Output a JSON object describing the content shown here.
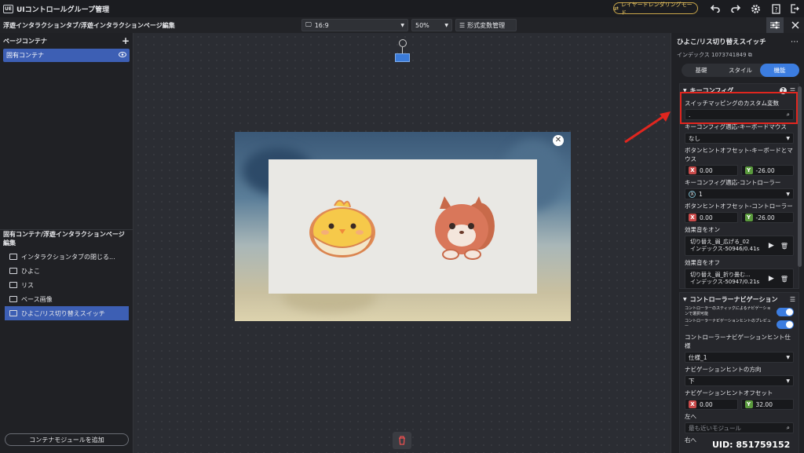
{
  "app": {
    "icon_text": "UE",
    "title": "UIコントロールグループ管理",
    "layer_mode": "レイヤードレンダリングモード"
  },
  "toolbar": {
    "breadcrumb": "浮遊インタラクションタブ/浮遊インタラクションページ編集",
    "aspect": "16:9",
    "zoom": "50%",
    "format_vars": "形式変数管理"
  },
  "left_panel": {
    "page_content_title": "ページコンテナ",
    "fixed_container": "固有コンテナ",
    "tree_title": "固有コンテナ/浮遊インタラクションページ編集",
    "tree_items": [
      {
        "label": "インタラクションタブの閉じる..."
      },
      {
        "label": "ひよこ"
      },
      {
        "label": "リス"
      },
      {
        "label": "ベース画像"
      },
      {
        "label": "ひよこ/リス切り替えスイッチ"
      }
    ],
    "add_module": "コンテナモジュールを追加"
  },
  "right_panel": {
    "title": "ひよこ/リス切り替えスイッチ",
    "index": "インデックス 1073741849",
    "tabs": [
      "基礎",
      "スタイル",
      "機能"
    ],
    "key_config": {
      "header": "キーコンフィグ",
      "custom_var_label": "スイッチマッピングのカスタム変数",
      "custom_var_value": ".",
      "kbm_label": "キーコンフィグ適応-キーボードマウス",
      "kbm_value": "なし",
      "kbm_offset_label": "ボタンヒントオフセット-キーボードとマウス",
      "kbm_offset_x": "0.00",
      "kbm_offset_y": "-26.00",
      "ctrl_label": "キーコンフィグ適応-コントローラー",
      "ctrl_value": "1",
      "ctrl_offset_label": "ボタンヒントオフセット-コントローラー",
      "ctrl_offset_x": "0.00",
      "ctrl_offset_y": "-26.00",
      "sound_on_label": "効果音をオン",
      "sound_on_name": "切り替え_弱_広げる_02",
      "sound_on_meta": "インデックス-50946/0.41s",
      "sound_off_label": "効果音をオフ",
      "sound_off_name": "切り替え_弱_折り畳む...",
      "sound_off_meta": "インデックス-50947/0.21s"
    },
    "controller_nav": {
      "header": "コントローラーナビゲーション",
      "toggle1": "コントローラーのスティックによるナビゲーションで選択可能",
      "toggle2": "コントローラーナビゲーションヒントのプレビュー",
      "spec_label": "コントローラーナビゲーションヒント仕様",
      "spec_value": "仕様_1",
      "dir_label": "ナビゲーションヒントの方向",
      "dir_value": "下",
      "offset_label": "ナビゲーションヒントオフセット",
      "offset_x": "0.00",
      "offset_y": "32.00",
      "left_label": "左へ",
      "left_placeholder": "最も近いモジュール",
      "right_label": "右へ"
    }
  },
  "watermark": "UID: 851759152"
}
